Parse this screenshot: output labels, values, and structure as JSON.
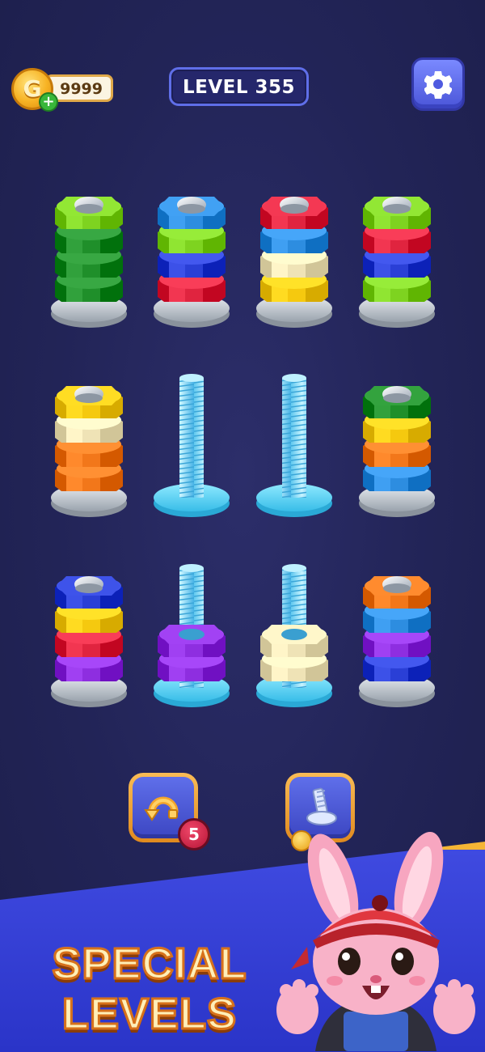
{
  "hud": {
    "coins": "9999",
    "coin_glyph": "G",
    "add_coins_glyph": "+",
    "level": "LEVEL 355",
    "settings_icon": "gear-icon"
  },
  "pegs": [
    {
      "id": "peg-1",
      "nuts": [
        "green-light",
        "green",
        "green",
        "green"
      ],
      "top_cap": true
    },
    {
      "id": "peg-2",
      "nuts": [
        "blue",
        "green-light",
        "blue-dark",
        "red"
      ],
      "top_cap": true
    },
    {
      "id": "peg-3",
      "nuts": [
        "red",
        "blue",
        "cream",
        "yellow"
      ],
      "top_cap": true
    },
    {
      "id": "peg-4",
      "nuts": [
        "green-light",
        "red",
        "blue-dark",
        "green-light"
      ],
      "top_cap": true
    },
    {
      "id": "peg-5",
      "nuts": [
        "yellow",
        "cream",
        "orange",
        "orange"
      ],
      "top_cap": true
    },
    {
      "id": "peg-6",
      "nuts": [],
      "top_cap": false
    },
    {
      "id": "peg-7",
      "nuts": [],
      "top_cap": false
    },
    {
      "id": "peg-8",
      "nuts": [
        "green",
        "yellow",
        "orange",
        "blue"
      ],
      "top_cap": true
    },
    {
      "id": "peg-9",
      "nuts": [
        "blue-dark",
        "yellow",
        "red",
        "purple"
      ],
      "top_cap": true
    },
    {
      "id": "peg-10",
      "nuts": [
        "purple",
        "purple"
      ],
      "top_cap": false
    },
    {
      "id": "peg-11",
      "nuts": [
        "cream",
        "cream"
      ],
      "top_cap": false
    },
    {
      "id": "peg-12",
      "nuts": [
        "orange",
        "blue",
        "purple",
        "blue-dark"
      ],
      "top_cap": true
    }
  ],
  "colors": {
    "background": "#222457",
    "green-light": "#7ed320",
    "green": "#1f8f2a",
    "blue": "#2d8de0",
    "blue-dark": "#2a3fd6",
    "red": "#e0243f",
    "cream": "#efe3b6",
    "yellow": "#f5c90f",
    "orange": "#f2771a",
    "purple": "#8e2ee0",
    "empty_peg": "#8fe7ff",
    "accent_orange": "#e08a1f"
  },
  "boosters": {
    "undo": {
      "icon": "undo-magnet-icon",
      "count": "5"
    },
    "add_bolt": {
      "icon": "bolt-icon",
      "price_icon": "coin-icon"
    }
  },
  "banner": {
    "line1": "SPECIAL",
    "line2": "LEVELS",
    "mascot": "bunny-mascot"
  }
}
